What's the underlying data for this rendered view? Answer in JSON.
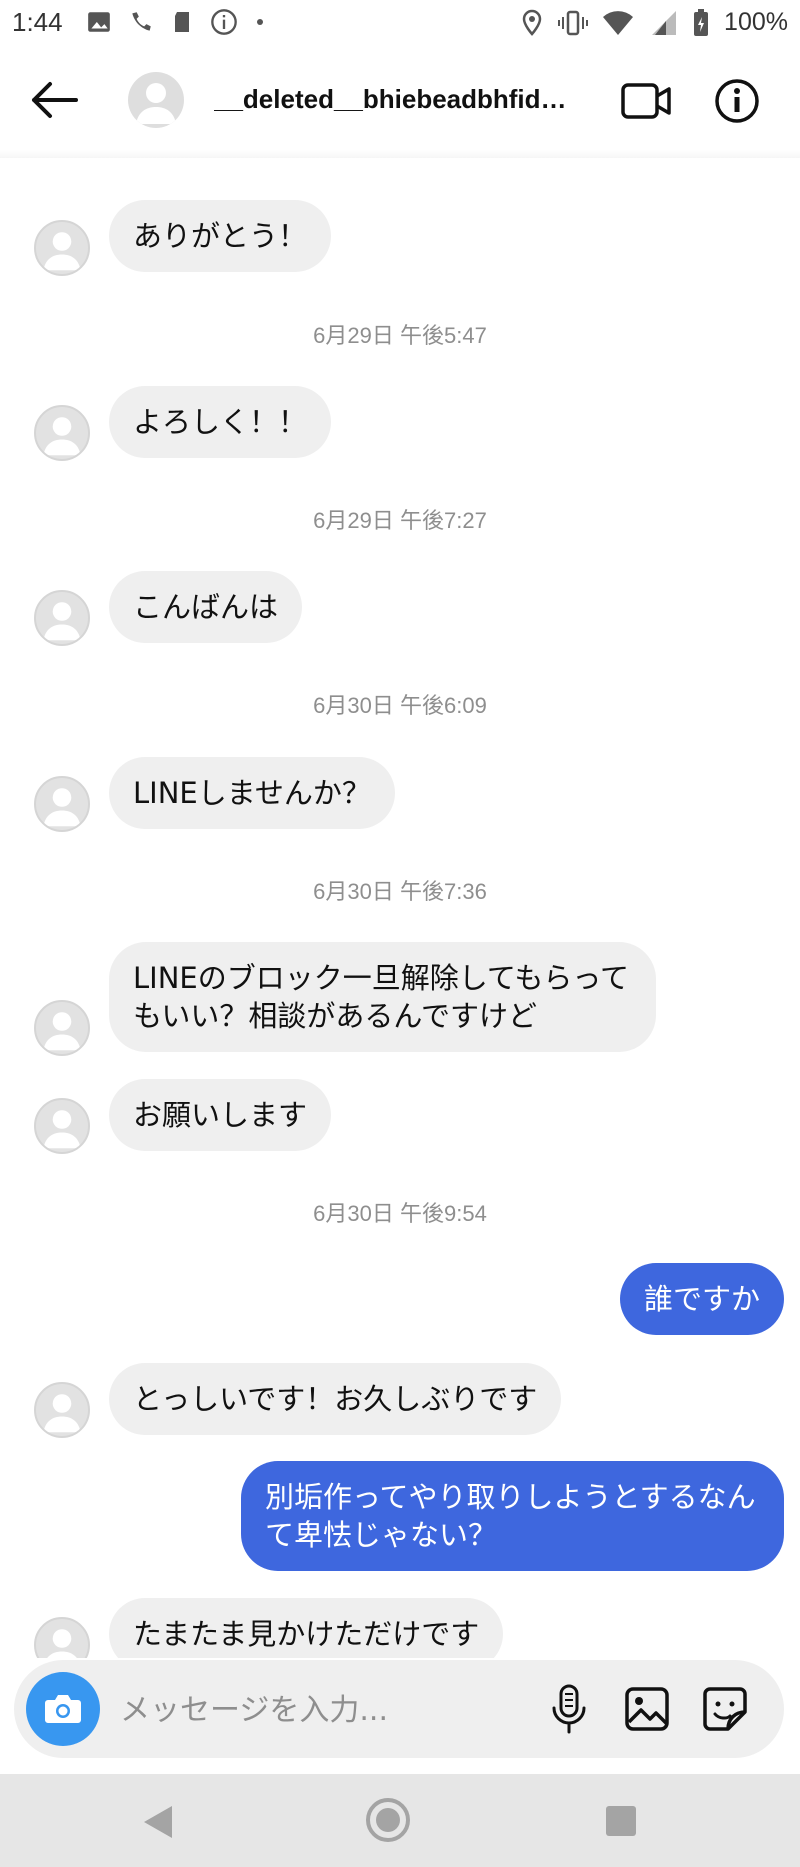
{
  "status_bar": {
    "time": "1:44",
    "battery": "100%",
    "icons_left": [
      "image-icon",
      "call-forward-icon",
      "sd-card-icon",
      "info-circle-icon",
      "dot-icon"
    ],
    "icons_right": [
      "location-icon",
      "vibrate-icon",
      "wifi-icon",
      "signal-icon",
      "battery-icon"
    ]
  },
  "header": {
    "username": "__deleted__bhiebeadbhfidb..."
  },
  "messages": [
    {
      "type": "in",
      "text": "ありがとう！"
    },
    {
      "type": "timestamp",
      "text": "6月29日 午後5:47"
    },
    {
      "type": "in",
      "text": "よろしく！！"
    },
    {
      "type": "timestamp",
      "text": "6月29日 午後7:27"
    },
    {
      "type": "in",
      "text": "こんばんは"
    },
    {
      "type": "timestamp",
      "text": "6月30日 午後6:09"
    },
    {
      "type": "in",
      "text": "LINEしませんか？"
    },
    {
      "type": "timestamp",
      "text": "6月30日 午後7:36"
    },
    {
      "type": "in",
      "text": "LINEのブロック一旦解除してもらってもいい？相談があるんですけど"
    },
    {
      "type": "in",
      "text": "お願いします"
    },
    {
      "type": "timestamp",
      "text": "6月30日 午後9:54"
    },
    {
      "type": "out",
      "text": "誰ですか"
    },
    {
      "type": "in",
      "text": "とっしいです！お久しぶりです"
    },
    {
      "type": "out",
      "text": "別垢作ってやり取りしようとするなんて卑怯じゃない？"
    },
    {
      "type": "in",
      "text": "たまたま見かけただけです"
    }
  ],
  "composer": {
    "placeholder": "メッセージを入力..."
  },
  "colors": {
    "outgoing_bubble": "#3e67de",
    "incoming_bubble": "#efefef",
    "camera_button": "#3897f0",
    "timestamp": "#8e8e8e"
  }
}
